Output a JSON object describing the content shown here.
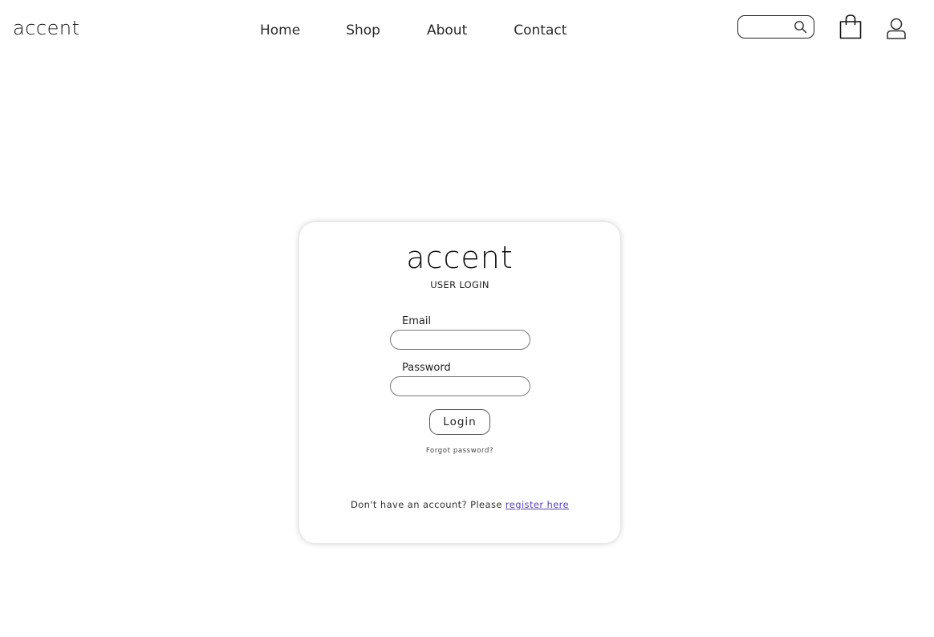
{
  "header": {
    "brand": "accent",
    "nav": [
      "Home",
      "Shop",
      "About",
      "Contact"
    ],
    "search": {
      "placeholder": "",
      "value": ""
    },
    "icons": [
      "search-icon",
      "shopping-bag-icon",
      "user-icon"
    ]
  },
  "login": {
    "brand": "accent",
    "subtitle": "USER LOGIN",
    "email_label": "Email",
    "email_value": "",
    "password_label": "Password",
    "password_value": "",
    "button_label": "Login",
    "forgot_link": "Forgot password?",
    "register_prompt": "Don't have an account? Please",
    "register_link": "register here"
  },
  "colors": {
    "link": "#5b3fc4",
    "text": "#222222",
    "background": "#ffffff"
  }
}
